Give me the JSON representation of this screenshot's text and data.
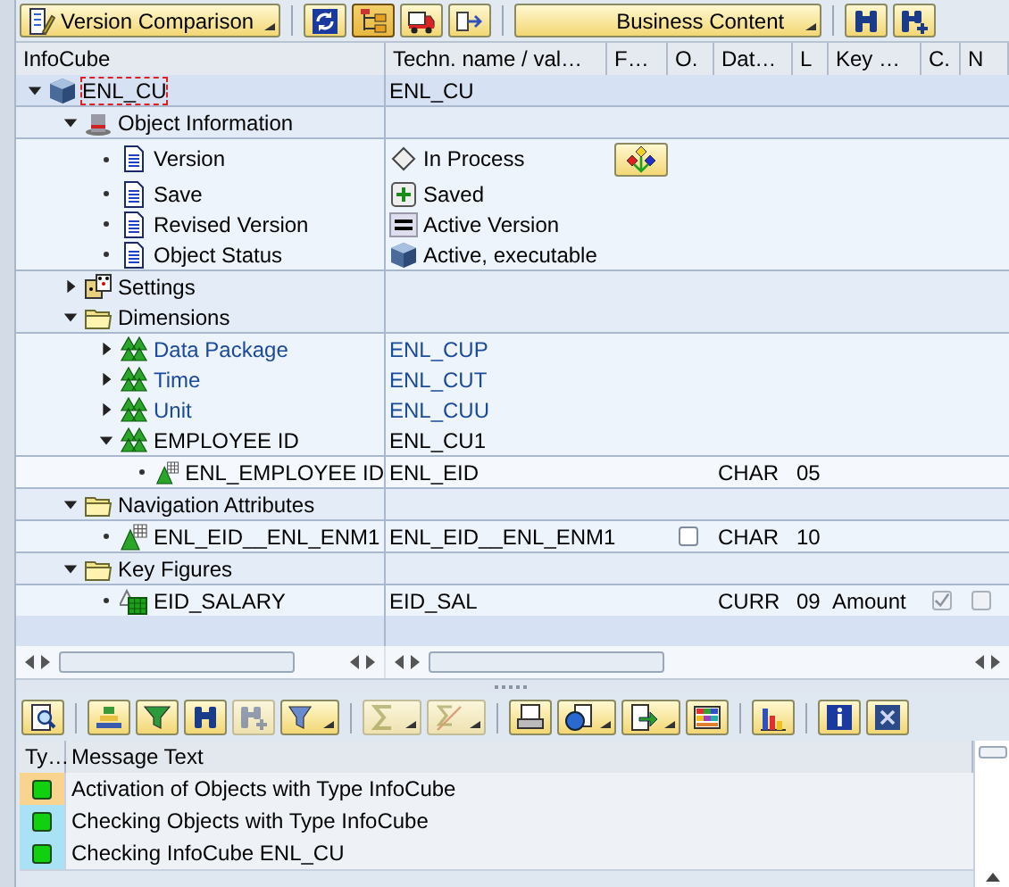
{
  "toolbar": [
    {
      "kind": "icon-menu",
      "label": "Version Comparison"
    },
    {
      "kind": "separator"
    },
    {
      "kind": "icon",
      "pressed": false
    },
    {
      "kind": "icon",
      "pressed": true
    },
    {
      "kind": "icon",
      "pressed": false
    },
    {
      "kind": "icon",
      "pressed": false
    },
    {
      "kind": "separator"
    },
    {
      "kind": "menu",
      "label": "Business Content"
    },
    {
      "kind": "separator"
    },
    {
      "kind": "icon",
      "pressed": false
    },
    {
      "kind": "icon",
      "pressed": false
    }
  ],
  "tree": {
    "columns": [
      "InfoCube",
      "Techn. name / val…",
      "F…",
      "O.",
      "Dat…",
      "L",
      "Key …",
      "C.",
      "N"
    ],
    "nodes": [
      {
        "label": "ENL_CU",
        "kind": "cube",
        "tech": "ENL_CU",
        "expanded": true,
        "focused": true,
        "children": [
          {
            "label": "Object Information",
            "kind": "info",
            "expanded": true,
            "children": [
              {
                "label": "Version",
                "kind": "document",
                "value": {
                  "text": "In Process",
                  "kind": "in-process"
                },
                "button": true
              },
              {
                "label": "Save",
                "kind": "document",
                "value": {
                  "text": "Saved",
                  "kind": "saved"
                },
                "button": false
              },
              {
                "label": "Revised Version",
                "kind": "document",
                "value": {
                  "text": "Active Version",
                  "kind": "version"
                },
                "button": false
              },
              {
                "label": "Object Status",
                "kind": "document",
                "value": {
                  "text": "Active, executable",
                  "kind": "active"
                },
                "button": false
              }
            ]
          },
          {
            "label": "Settings",
            "kind": "settings",
            "expanded": false
          },
          {
            "label": "Dimensions",
            "kind": "folder",
            "expanded": true,
            "children": [
              {
                "label": "Data Package",
                "kind": "dimension",
                "tech": "ENL_CUP",
                "expanded": false,
                "link": true
              },
              {
                "label": "Time",
                "kind": "dimension",
                "tech": "ENL_CUT",
                "expanded": false,
                "link": true
              },
              {
                "label": "Unit",
                "kind": "dimension",
                "tech": "ENL_CUU",
                "expanded": false,
                "link": true
              },
              {
                "label": "EMPLOYEE ID",
                "kind": "dimension",
                "tech": "ENL_CU1",
                "expanded": true,
                "link": false,
                "children": [
                  {
                    "label": "ENL_EMPLOYEE ID",
                    "kind": "characteristic",
                    "tech": "ENL_EID",
                    "data_type": "CHAR",
                    "length": "05"
                  }
                ]
              }
            ]
          },
          {
            "label": "Navigation Attributes",
            "kind": "folder",
            "expanded": true,
            "children": [
              {
                "label": "ENL_EID__ENL_ENM1",
                "kind": "characteristic",
                "tech": "ENL_EID__ENL_ENM1",
                "o": {
                  "checked": false
                },
                "data_type": "CHAR",
                "length": "10"
              }
            ]
          },
          {
            "label": "Key Figures",
            "kind": "folder",
            "expanded": true,
            "children": [
              {
                "label": "EID_SALARY",
                "kind": "key-figure",
                "tech": "EID_SAL",
                "data_type": "CURR",
                "length": "09",
                "key_type": "Amount",
                "c": {
                  "checked": true,
                  "disabled": true
                },
                "n": {
                  "checked": false,
                  "disabled": true
                }
              }
            ]
          }
        ]
      }
    ]
  },
  "message_toolbar": [
    {
      "kind": "icon",
      "disabled": false,
      "dropdown": false
    },
    {
      "kind": "separator"
    },
    {
      "kind": "icon",
      "disabled": false,
      "dropdown": false
    },
    {
      "kind": "icon",
      "disabled": false,
      "dropdown": false
    },
    {
      "kind": "icon",
      "disabled": false,
      "dropdown": false
    },
    {
      "kind": "icon",
      "disabled": true,
      "dropdown": false
    },
    {
      "kind": "icon",
      "disabled": false,
      "dropdown": true
    },
    {
      "kind": "separator"
    },
    {
      "kind": "icon",
      "disabled": true,
      "dropdown": true
    },
    {
      "kind": "icon",
      "disabled": true,
      "dropdown": true
    },
    {
      "kind": "separator"
    },
    {
      "kind": "icon",
      "disabled": false,
      "dropdown": false
    },
    {
      "kind": "icon",
      "disabled": false,
      "dropdown": true
    },
    {
      "kind": "icon",
      "disabled": false,
      "dropdown": true
    },
    {
      "kind": "icon",
      "disabled": false,
      "dropdown": false
    },
    {
      "kind": "separator"
    },
    {
      "kind": "icon",
      "disabled": false,
      "dropdown": false
    },
    {
      "kind": "separator"
    },
    {
      "kind": "icon",
      "disabled": false,
      "dropdown": false
    },
    {
      "kind": "icon",
      "disabled": false,
      "dropdown": false
    }
  ],
  "messages": {
    "columns": [
      "Ty…",
      "Message Text"
    ],
    "rows": [
      {
        "kind": "success",
        "selected": true,
        "text": "Activation of Objects with Type InfoCube"
      },
      {
        "kind": "success",
        "selected": false,
        "text": "Checking Objects with Type InfoCube"
      },
      {
        "kind": "success",
        "selected": false,
        "text": "Checking InfoCube ENL_CU"
      }
    ]
  }
}
